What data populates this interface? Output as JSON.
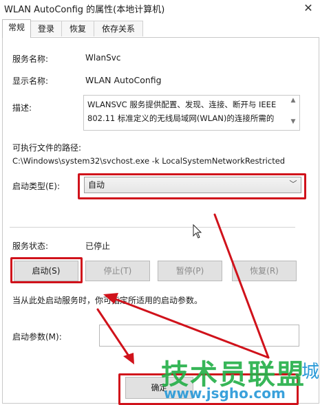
{
  "window": {
    "title": "WLAN AutoConfig 的属性(本地计算机)",
    "close_glyph": "✕"
  },
  "tabs": [
    {
      "label": "常规",
      "active": true
    },
    {
      "label": "登录",
      "active": false
    },
    {
      "label": "恢复",
      "active": false
    },
    {
      "label": "依存关系",
      "active": false
    }
  ],
  "general": {
    "service_name_label": "服务名称:",
    "service_name_value": "WlanSvc",
    "display_name_label": "显示名称:",
    "display_name_value": "WLAN AutoConfig",
    "description_label": "描述:",
    "description_line1": "WLANSVC 服务提供配置、发现、连接、断开与 IEEE",
    "description_line2": "802.11 标准定义的无线局域网(WLAN)的连接所需的",
    "path_label": "可执行文件的路径:",
    "path_value": "C:\\Windows\\system32\\svchost.exe -k LocalSystemNetworkRestricted",
    "startup_type_label": "启动类型(E):",
    "startup_type_value": "自动",
    "service_status_label": "服务状态:",
    "service_status_value": "已停止",
    "start_button": "启动(S)",
    "stop_button": "停止(T)",
    "pause_button": "暂停(P)",
    "resume_button": "恢复(R)",
    "hint": "当从此处启动服务时，你可指定所适用的启动参数。",
    "start_params_label": "启动参数(M):",
    "start_params_value": "",
    "ok_button": "确定"
  },
  "watermark": {
    "text": "技术员联盟",
    "url": "www.jsgho.com",
    "side": "城"
  },
  "colors": {
    "highlight": "#d0121b",
    "watermark_green": "#27b04a",
    "watermark_blue": "#2a9ad8"
  }
}
